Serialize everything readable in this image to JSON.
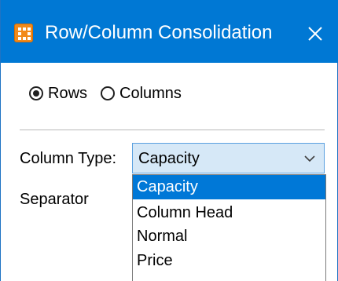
{
  "window": {
    "title": "Row/Column Consolidation",
    "accent_color": "#0078d4",
    "app_icon": "orange-grid-icon",
    "close_icon": "close-icon"
  },
  "consolidate_by": {
    "options": [
      {
        "label": "Rows",
        "checked": true
      },
      {
        "label": "Columns",
        "checked": false
      }
    ]
  },
  "column_type": {
    "label": "Column Type:",
    "selected_value": "Capacity",
    "chevron_icon": "chevron-down-icon",
    "dropdown_options": [
      "Capacity",
      "Column Head",
      "Normal",
      "Price"
    ],
    "highlighted_option": "Capacity",
    "highlight_color": "#0078d7"
  },
  "separator": {
    "label": "Separator"
  }
}
